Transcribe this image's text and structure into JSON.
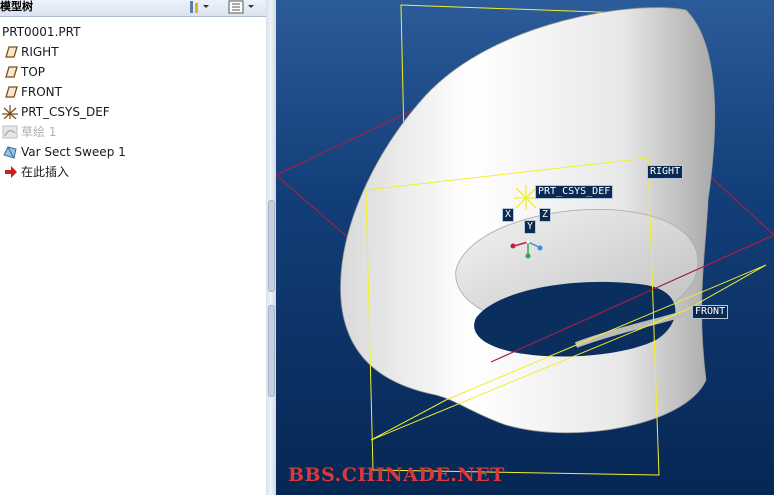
{
  "tree": {
    "title": "模型树",
    "items": [
      {
        "label": "PRT0001.PRT",
        "icon": "part-icon"
      },
      {
        "label": "RIGHT",
        "icon": "datum-plane-icon"
      },
      {
        "label": "TOP",
        "icon": "datum-plane-icon"
      },
      {
        "label": "FRONT",
        "icon": "datum-plane-icon"
      },
      {
        "label": "PRT_CSYS_DEF",
        "icon": "csys-icon"
      },
      {
        "label": "草绘 1",
        "icon": "sketch-icon"
      },
      {
        "label": "Var Sect Sweep 1",
        "icon": "sweep-icon"
      },
      {
        "label": "在此插入",
        "icon": "insert-arrow-icon"
      }
    ]
  },
  "viewport": {
    "labels": {
      "csys": "PRT_CSYS_DEF",
      "right": "RIGHT",
      "front": "FRONT",
      "axis_x": "X",
      "axis_y": "Y",
      "axis_z": "Z"
    },
    "watermark": "BBS.CHINADE.NET",
    "colors": {
      "background_top": "#2c5b99",
      "background_bottom": "#062754",
      "datum_plane_yellow": "#f2ef2a",
      "datum_plane_red": "#a0204a",
      "watermark_red": "#d83a3a"
    }
  }
}
